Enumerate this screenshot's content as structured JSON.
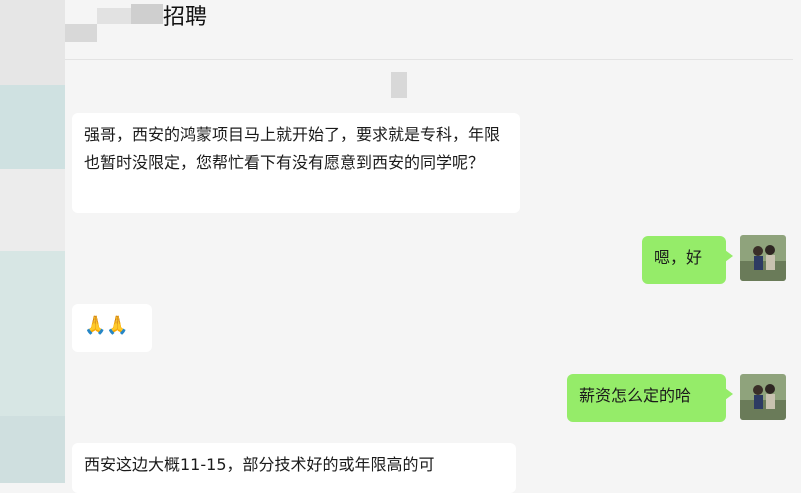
{
  "chat": {
    "title": "招聘",
    "messages": [
      {
        "from": "other",
        "text": "强哥，西安的鸿蒙项目马上就开始了，要求就是专科，年限也暂时没限定，您帮忙看下有没有愿意到西安的同学呢？"
      },
      {
        "from": "me",
        "text": "嗯，好"
      },
      {
        "from": "other",
        "text": "🙏🙏"
      },
      {
        "from": "me",
        "text": "薪资怎么定的哈"
      },
      {
        "from": "other",
        "text": "西安这边大概11-15，部分技术好的或年限高的可"
      }
    ]
  },
  "colors": {
    "my_bubble": "#95ec69",
    "other_bubble": "#ffffff",
    "background": "#f5f5f5"
  }
}
